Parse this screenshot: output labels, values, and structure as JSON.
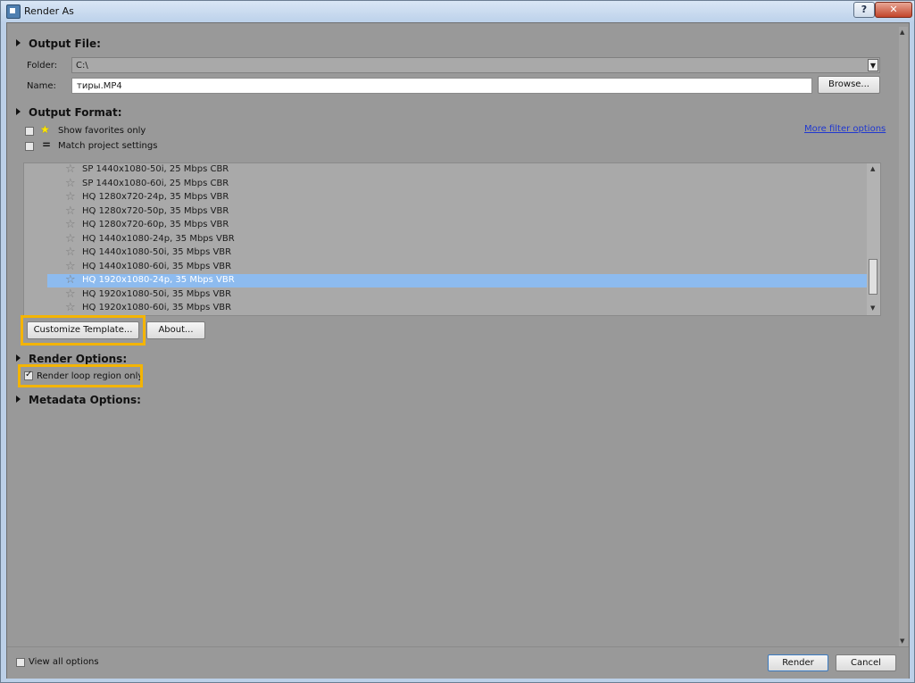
{
  "window": {
    "title": "Render As",
    "help": "?",
    "close": "✕"
  },
  "output_file": {
    "header": "Output File:",
    "folder_label": "Folder:",
    "folder_value": "C:\\",
    "name_label": "Name:",
    "name_value": "тиры.MP4",
    "browse": "Browse..."
  },
  "output_format": {
    "header": "Output Format:",
    "show_favorites": "Show favorites only",
    "match_project": "Match project settings",
    "more_filter": "More filter options",
    "templates": [
      "SP 1440x1080-50i, 25 Mbps CBR",
      "SP 1440x1080-60i, 25 Mbps CBR",
      "HQ 1280x720-24p, 35 Mbps VBR",
      "HQ 1280x720-50p, 35 Mbps VBR",
      "HQ 1280x720-60p, 35 Mbps VBR",
      "HQ 1440x1080-24p, 35 Mbps VBR",
      "HQ 1440x1080-50i, 35 Mbps VBR",
      "HQ 1440x1080-60i, 35 Mbps VBR",
      "HQ 1920x1080-24p, 35 Mbps VBR",
      "HQ 1920x1080-50i, 35 Mbps VBR",
      "HQ 1920x1080-60i, 35 Mbps VBR"
    ],
    "selected_index": 8,
    "customize": "Customize Template...",
    "about": "About..."
  },
  "render_options": {
    "header": "Render Options:",
    "loop_region": "Render loop region only",
    "loop_checked": true
  },
  "metadata_options": {
    "header": "Metadata Options:"
  },
  "footer": {
    "view_all": "View all options",
    "render": "Render",
    "cancel": "Cancel"
  },
  "colors": {
    "highlight": "#f4b400",
    "selection": "#8dbbef",
    "link": "#2038d0",
    "panel": "#999999"
  }
}
